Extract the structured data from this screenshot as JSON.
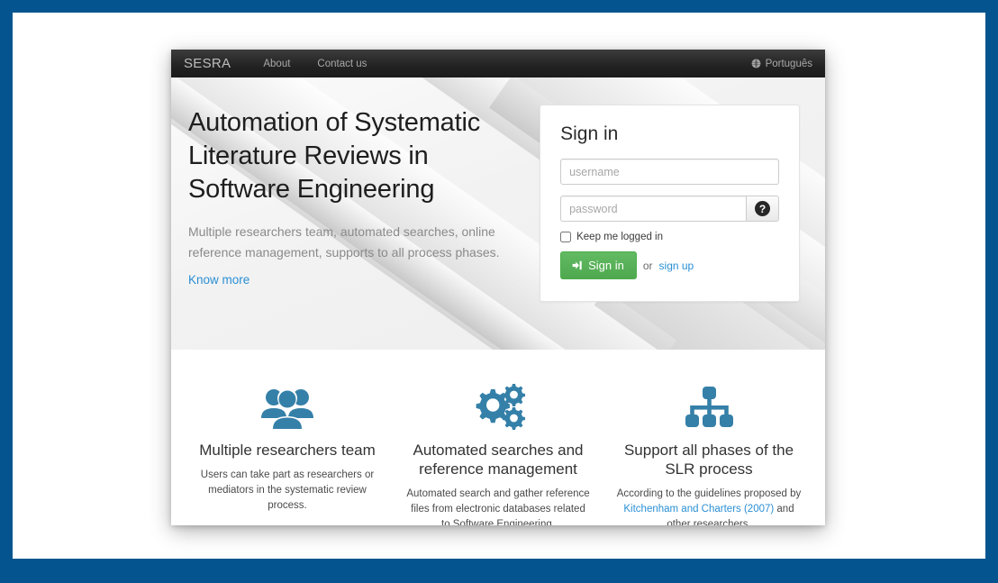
{
  "navbar": {
    "brand": "SESRA",
    "links": [
      {
        "label": "About"
      },
      {
        "label": "Contact us"
      }
    ],
    "language": {
      "label": "Português",
      "icon": "globe-icon"
    }
  },
  "hero": {
    "headline": "Automation of Systematic Literature Reviews in Software Engineering",
    "subhead": "Multiple researchers team, automated searches, online reference management, supports to all process phases.",
    "know_more": "Know more"
  },
  "signin": {
    "title": "Sign in",
    "username_placeholder": "username",
    "username_value": "",
    "password_placeholder": "password",
    "password_value": "",
    "help_icon": "question-mark-icon",
    "keep_logged_label": "Keep me logged in",
    "keep_logged_checked": false,
    "submit_label": "Sign in",
    "submit_icon": "sign-in-arrow-icon",
    "or_text": "or",
    "signup_label": "sign up"
  },
  "features": [
    {
      "icon": "users-group-icon",
      "title": "Multiple researchers team",
      "desc": "Users can take part as researchers or mediators in the systematic review process."
    },
    {
      "icon": "cogs-icon",
      "title": "Automated searches and reference management",
      "desc": "Automated search and gather reference files from electronic databases related to Software Engineering."
    },
    {
      "icon": "sitemap-icon",
      "title": "Support all phases of the SLR process",
      "desc_before": "According to the guidelines proposed by ",
      "desc_link": "Kitchenham and Charters (2007)",
      "desc_after": " and other researchers."
    }
  ],
  "colors": {
    "frame_blue": "#04558f",
    "navbar_dark": "#222222",
    "link_blue": "#2a8fd4",
    "button_green": "#5cb85c",
    "icon_blue": "#3580a8"
  }
}
